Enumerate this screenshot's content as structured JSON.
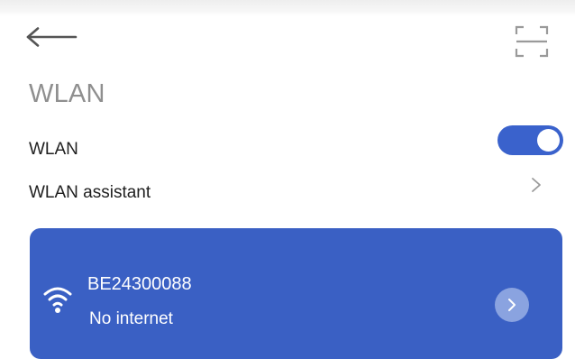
{
  "header": {
    "back_icon": "arrow-left-icon",
    "scan_icon": "scan-frame-icon",
    "title": "WLAN"
  },
  "settings": {
    "wlan": {
      "label": "WLAN",
      "enabled": true
    },
    "assistant": {
      "label": "WLAN assistant",
      "icon": "chevron-right-icon"
    }
  },
  "connected_network": {
    "ssid": "BE24300088",
    "status": "No internet",
    "icon": "wifi-icon",
    "details_icon": "chevron-right-icon"
  },
  "colors": {
    "accent": "#3a62cc",
    "card": "#3a60c4",
    "title_gray": "#8f8f8f",
    "details_button": "#8aa3e0"
  }
}
